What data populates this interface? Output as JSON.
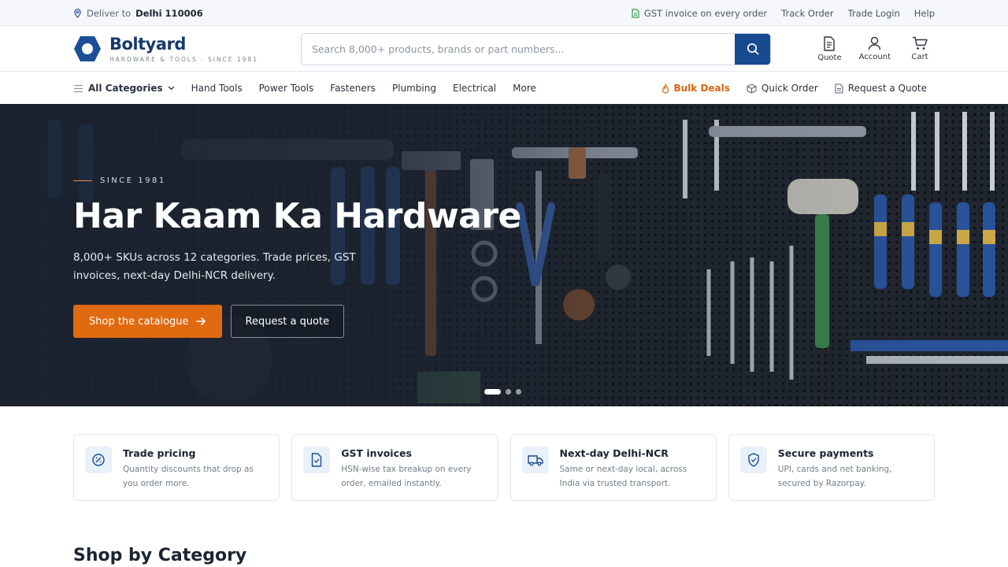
{
  "utility": {
    "deliver_prefix": "Deliver to",
    "deliver_location": "Delhi 110006",
    "links": [
      "GST invoice on every order",
      "Track Order",
      "Trade Login",
      "Help"
    ]
  },
  "header": {
    "brand": "Boltyard",
    "tagline": "HARDWARE & TOOLS · SINCE 1981",
    "search_placeholder": "Search 8,000+ products, brands or part numbers...",
    "actions": [
      {
        "label": "Quote",
        "icon": "document-icon"
      },
      {
        "label": "Account",
        "icon": "user-icon"
      },
      {
        "label": "Cart",
        "icon": "cart-icon"
      }
    ]
  },
  "nav": {
    "all_categories": "All Categories",
    "items": [
      "Hand Tools",
      "Power Tools",
      "Fasteners",
      "Plumbing",
      "Electrical",
      "More"
    ],
    "right": {
      "bulk": "Bulk Deals",
      "quick_order": "Quick Order",
      "request_quote": "Request a Quote"
    }
  },
  "hero": {
    "eyebrow": "SINCE 1981",
    "title": "Har Kaam Ka Hardware",
    "subtitle": "8,000+ SKUs across 12 categories. Trade prices, GST invoices, next-day Delhi-NCR delivery.",
    "primary_cta": "Shop the catalogue",
    "secondary_cta": "Request a quote",
    "slide_count": 3,
    "active_slide": 1
  },
  "features": [
    {
      "title": "Trade pricing",
      "desc": "Quantity discounts that drop as you order more.",
      "icon": "discount-icon"
    },
    {
      "title": "GST invoices",
      "desc": "HSN-wise tax breakup on every order, emailed instantly.",
      "icon": "invoice-icon"
    },
    {
      "title": "Next-day Delhi-NCR",
      "desc": "Same or next-day local, across India via trusted transport.",
      "icon": "truck-icon"
    },
    {
      "title": "Secure payments",
      "desc": "UPI, cards and net banking, secured by Razorpay.",
      "icon": "shield-icon"
    }
  ],
  "sections": {
    "shop_by_category": "Shop by Category"
  },
  "colors": {
    "brand_navy": "#173a6b",
    "primary_blue": "#174a8f",
    "accent_orange": "#e06a10"
  }
}
